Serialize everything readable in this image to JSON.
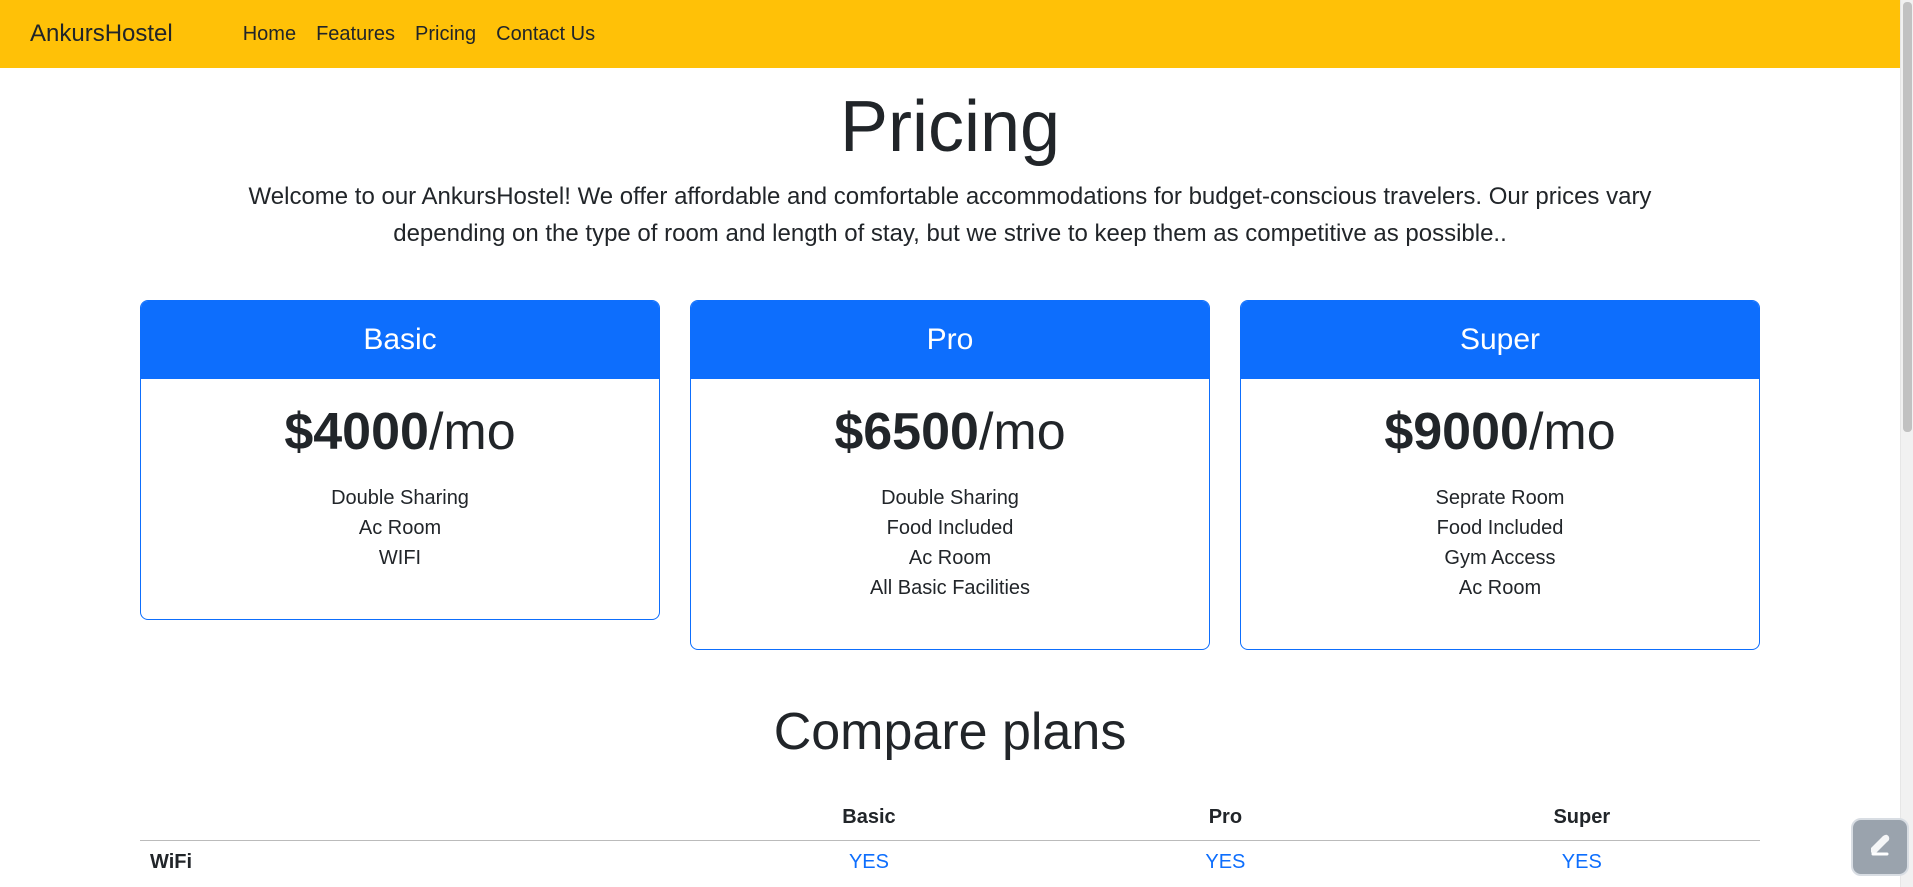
{
  "navbar": {
    "brand": "AnkursHostel",
    "links": [
      "Home",
      "Features",
      "Pricing",
      "Contact Us"
    ],
    "background": "#ffc107"
  },
  "pricing": {
    "title": "Pricing",
    "intro": "Welcome to our AnkursHostel! We offer affordable and comfortable accommodations for budget-conscious travelers. Our prices vary depending on the type of room and length of stay, but we strive to keep them as competitive as possible.."
  },
  "plans": [
    {
      "name": "Basic",
      "price": "$4000",
      "period": "/mo",
      "features": [
        "Double Sharing",
        "Ac Room",
        "WIFI"
      ]
    },
    {
      "name": "Pro",
      "price": "$6500",
      "period": "/mo",
      "features": [
        "Double Sharing",
        "Food Included",
        "Ac Room",
        "All Basic Facilities"
      ]
    },
    {
      "name": "Super",
      "price": "$9000",
      "period": "/mo",
      "features": [
        "Seprate Room",
        "Food Included",
        "Gym Access",
        "Ac Room"
      ]
    }
  ],
  "compare": {
    "title": "Compare plans",
    "columns": [
      "",
      "Basic",
      "Pro",
      "Super"
    ],
    "rows": [
      {
        "feature": "WiFi",
        "values": [
          "YES",
          "YES",
          "YES"
        ]
      }
    ]
  },
  "colors": {
    "accent": "#0d6efd",
    "navbar": "#ffc107"
  },
  "widget": {
    "icon": "assistant-icon"
  }
}
